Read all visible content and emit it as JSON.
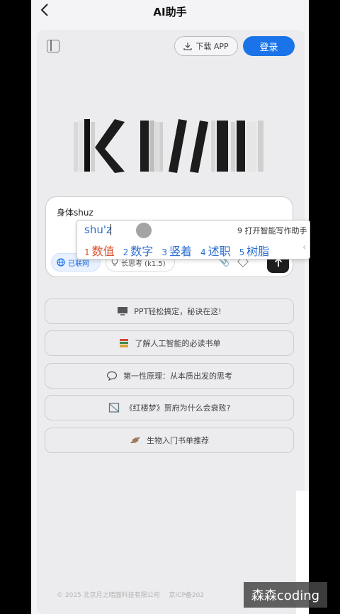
{
  "header": {
    "title": "AI助手",
    "back_icon": "chevron-left-icon"
  },
  "toolbar": {
    "download_label": "下载 APP",
    "login_label": "登录",
    "accent": "#1a73e8"
  },
  "logo": {
    "text": "KIMI"
  },
  "input": {
    "value": "身体shuz",
    "chips": [
      {
        "label": "已联网",
        "active": true
      },
      {
        "label": "长思考 (k1.5)",
        "active": false
      }
    ]
  },
  "ime": {
    "composition": "shu'z",
    "hint": "9 打开智能写作助手",
    "candidates": [
      {
        "num": "1",
        "text": "数值"
      },
      {
        "num": "2",
        "text": "数字"
      },
      {
        "num": "3",
        "text": "竖着"
      },
      {
        "num": "4",
        "text": "述职"
      },
      {
        "num": "5",
        "text": "树脂"
      }
    ]
  },
  "suggestions": [
    {
      "label": "PPT轻松搞定，秘诀在这!",
      "icon": "monitor-icon"
    },
    {
      "label": "了解人工智能的必读书单",
      "icon": "books-icon"
    },
    {
      "label": "第一性原理：从本质出发的思考",
      "icon": "chat-bubble-icon"
    },
    {
      "label": "《红楼梦》贾府为什么会衰败?",
      "icon": "image-frame-icon"
    },
    {
      "label": "生物入门书单推荐",
      "icon": "candy-icon"
    }
  ],
  "footer": {
    "copyright": "© 2025 北京月之暗面科技有限公司",
    "icp": "京ICP备202"
  },
  "watermark": "森森coding"
}
